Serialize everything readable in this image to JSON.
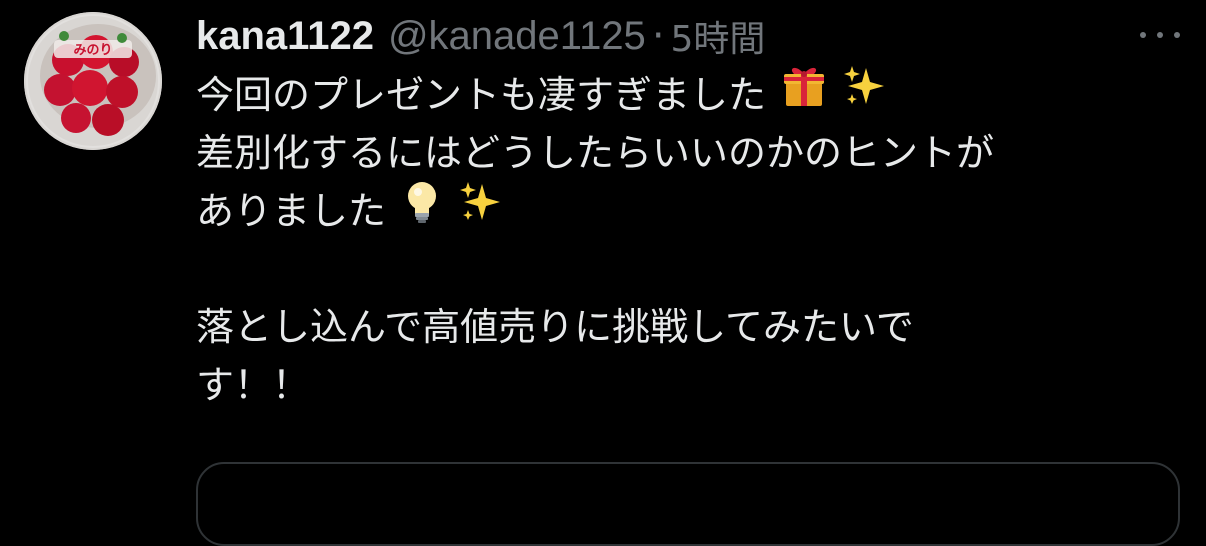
{
  "tweet": {
    "display_name": "kana1122",
    "handle": "@kanade1125",
    "separator": "·",
    "time": "5時間",
    "lines": [
      "今回のプレゼントも凄すぎました",
      "差別化するにはどうしたらいいのかのヒントが",
      "ありました",
      "",
      "落とし込んで高値売りに挑戦してみたいで",
      "す！！"
    ],
    "emojis": {
      "line1": [
        "gift-icon",
        "sparkles-icon"
      ],
      "line3": [
        "light-bulb-icon",
        "sparkles-icon"
      ]
    }
  },
  "colors": {
    "background": "#000000",
    "text_primary": "#e7e9ea",
    "text_secondary": "#71767b",
    "card_border": "#2f3336"
  }
}
